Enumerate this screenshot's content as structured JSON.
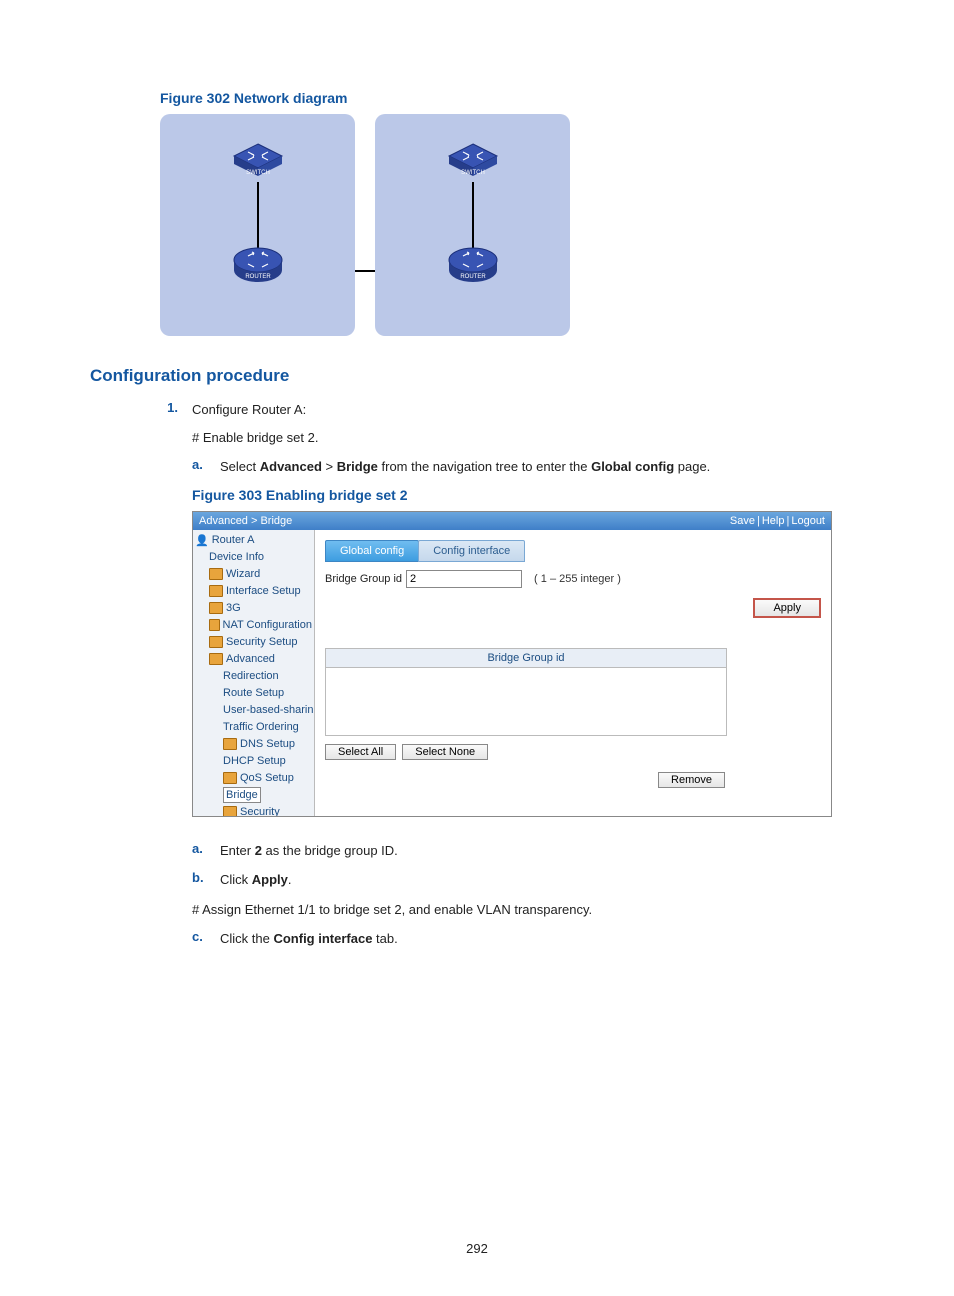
{
  "page_number": "292",
  "figure302": {
    "caption": "Figure 302 Network diagram",
    "switch_label": "SWITCH",
    "router_label": "ROUTER"
  },
  "section_title": "Configuration procedure",
  "step1": {
    "num": "1.",
    "text": "Configure Router A:",
    "sub_line": "# Enable bridge set 2.",
    "a": {
      "letter": "a.",
      "pre": "Select ",
      "b1": "Advanced",
      "mid": " > ",
      "b2": "Bridge",
      "post1": " from the navigation tree to enter the ",
      "b3": "Global config",
      "post2": " page."
    }
  },
  "figure303": {
    "caption": "Figure 303 Enabling bridge set 2",
    "breadcrumb": "Advanced > Bridge",
    "save": "Save",
    "help": "Help",
    "logout": "Logout",
    "tree": {
      "root": "Router A",
      "items": [
        "Device Info",
        "Wizard",
        "Interface Setup",
        "3G",
        "NAT Configuration",
        "Security Setup",
        "Advanced"
      ],
      "sub": [
        "Redirection",
        "Route Setup",
        "User-based-sharin",
        "Traffic Ordering",
        "DNS Setup",
        "DHCP Setup",
        "QoS Setup",
        "Bridge",
        "Security"
      ]
    },
    "tab_active": "Global config",
    "tab_inactive": "Config interface",
    "field_label": "Bridge Group id",
    "field_value": "2",
    "field_hint": "( 1 – 255 integer )",
    "apply": "Apply",
    "grid_header": "Bridge Group id",
    "select_all": "Select All",
    "select_none": "Select None",
    "remove": "Remove"
  },
  "steps_after": {
    "a2": {
      "letter": "a.",
      "pre": "Enter ",
      "b1": "2",
      "post": " as the bridge group ID."
    },
    "b2": {
      "letter": "b.",
      "pre": "Click ",
      "b1": "Apply",
      "post": "."
    },
    "assign_line": "# Assign Ethernet 1/1 to bridge set 2, and enable VLAN transparency.",
    "c2": {
      "letter": "c.",
      "pre": "Click the ",
      "b1": "Config interface",
      "post": " tab."
    }
  }
}
